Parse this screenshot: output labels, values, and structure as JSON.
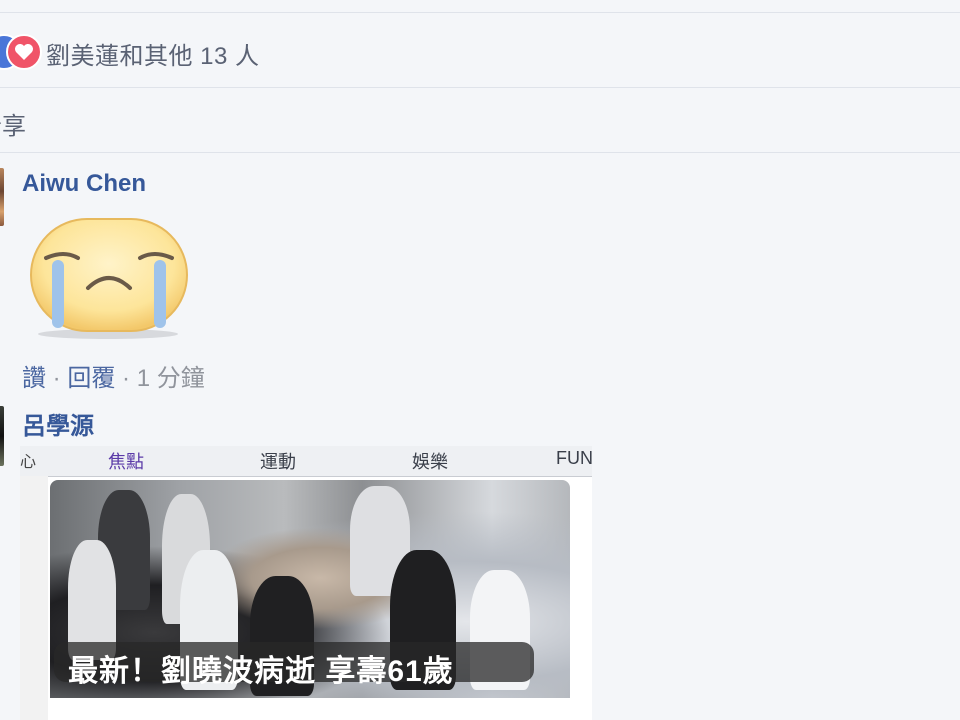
{
  "reactions": {
    "summary": "劉美蓮和其他 13 人"
  },
  "share": {
    "label": "分享"
  },
  "comments": [
    {
      "author": "Aiwu Chen",
      "sticker": "crying-face-sticker",
      "actions": {
        "like": "讚",
        "reply": "回覆",
        "time": "1 分鐘"
      }
    },
    {
      "author": "呂學源",
      "image": {
        "tabs": [
          "焦點",
          "運動",
          "娛樂",
          "FUN"
        ],
        "left_fragment": "心",
        "caption": "最新！劉曉波病逝 享壽61歲"
      }
    }
  ],
  "colors": {
    "link": "#365899",
    "meta_gray": "#90949c",
    "like_blue": "#4a76d8",
    "love_red": "#f05468",
    "background": "#f4f6f9"
  }
}
